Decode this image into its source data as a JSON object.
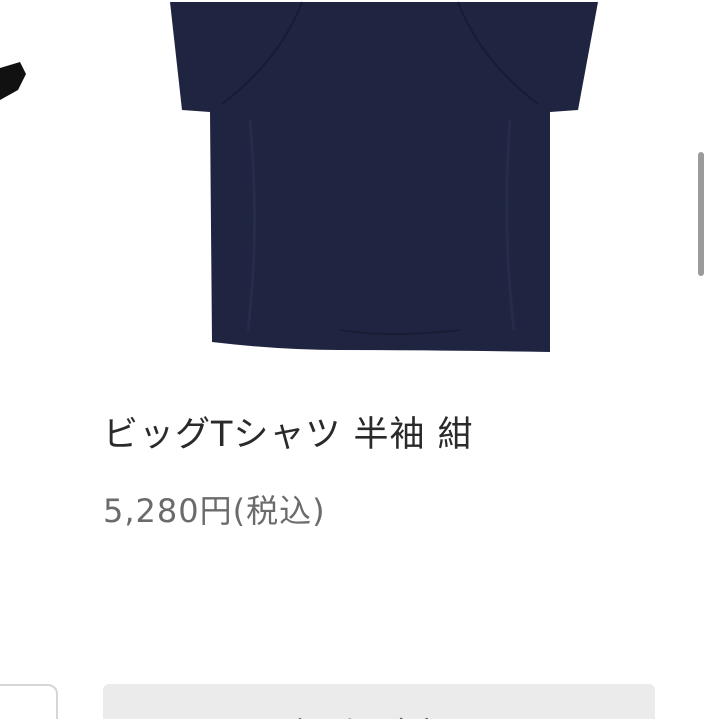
{
  "product": {
    "title": "ビッグTシャツ 半袖 紺",
    "price": "5,280円(税込)",
    "image_icon": "navy-tshirt-back-image",
    "color": "#1f2540"
  },
  "cart_button": {
    "label": "カートに入れる"
  },
  "colors": {
    "title_text": "#2a2a2a",
    "price_text": "#6b6b6b",
    "button_bg": "#ebebeb",
    "scrollbar": "#9b9b9b"
  }
}
